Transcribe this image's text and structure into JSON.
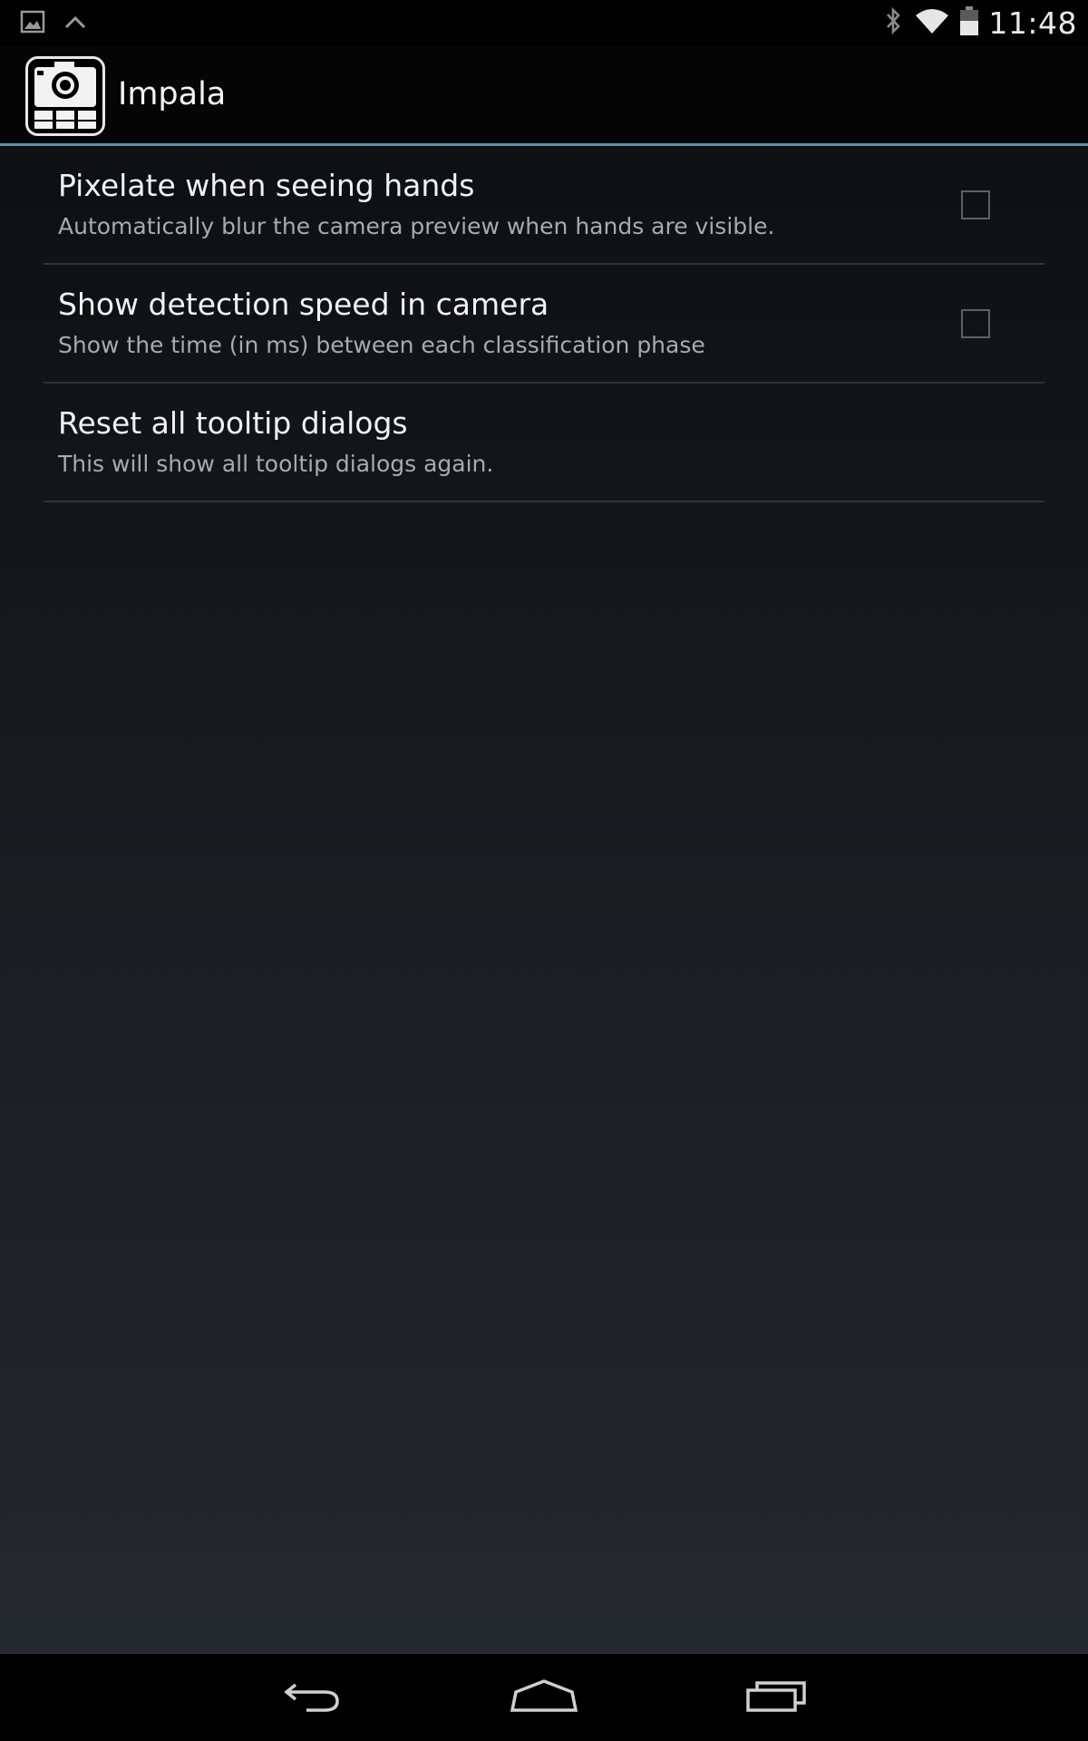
{
  "status_bar": {
    "time": "11:48",
    "icons": [
      "gallery-notification-icon",
      "chevron-up-icon",
      "bluetooth-icon",
      "wifi-icon",
      "battery-icon"
    ]
  },
  "action_bar": {
    "app_title": "Impala",
    "app_icon": "camera-app-icon",
    "accent_color": "#5f8fae"
  },
  "preferences": [
    {
      "title": "Pixelate when seeing hands",
      "summary": "Automatically blur the camera preview when hands are visible.",
      "has_checkbox": true,
      "checked": false
    },
    {
      "title": "Show detection speed in camera",
      "summary": "Show the time (in ms) between each classification phase",
      "has_checkbox": true,
      "checked": false
    },
    {
      "title": "Reset all tooltip dialogs",
      "summary": "This will show all tooltip dialogs again.",
      "has_checkbox": false
    }
  ],
  "nav_bar": {
    "buttons": [
      "back-icon",
      "home-icon",
      "recents-icon"
    ]
  }
}
